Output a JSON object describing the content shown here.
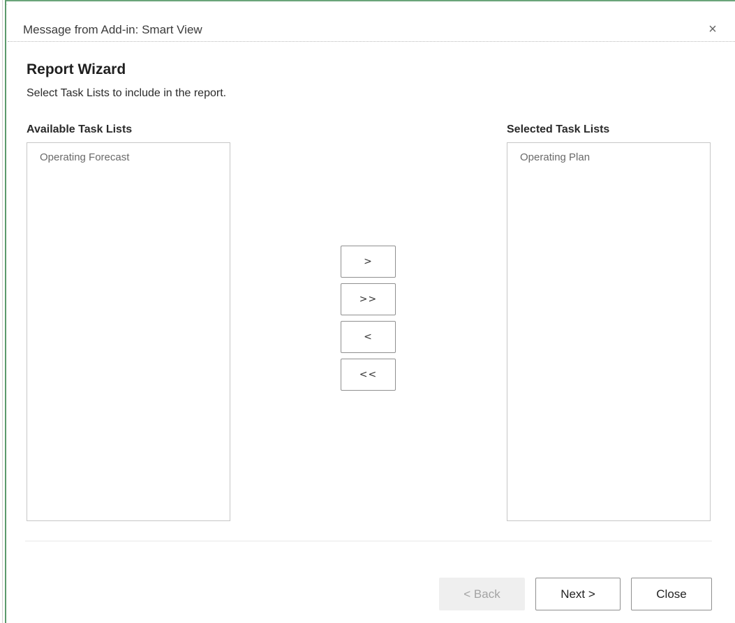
{
  "window": {
    "title": "Message from Add-in: Smart View",
    "close_icon": "×"
  },
  "wizard": {
    "heading": "Report Wizard",
    "instruction": "Select Task Lists to include in the report."
  },
  "available_list": {
    "label": "Available Task Lists",
    "items": [
      "Operating Forecast"
    ]
  },
  "selected_list": {
    "label": "Selected Task Lists",
    "items": [
      "Operating Plan"
    ]
  },
  "move_buttons": {
    "add": ">",
    "add_all": ">>",
    "remove": "<",
    "remove_all": "<<"
  },
  "footer": {
    "back_label": "< Back",
    "back_enabled": false,
    "next_label": "Next >",
    "close_label": "Close"
  },
  "colors": {
    "accent_green": "#5b9a6b",
    "disabled_bg": "#efefef",
    "disabled_text": "#a3a3a3"
  }
}
